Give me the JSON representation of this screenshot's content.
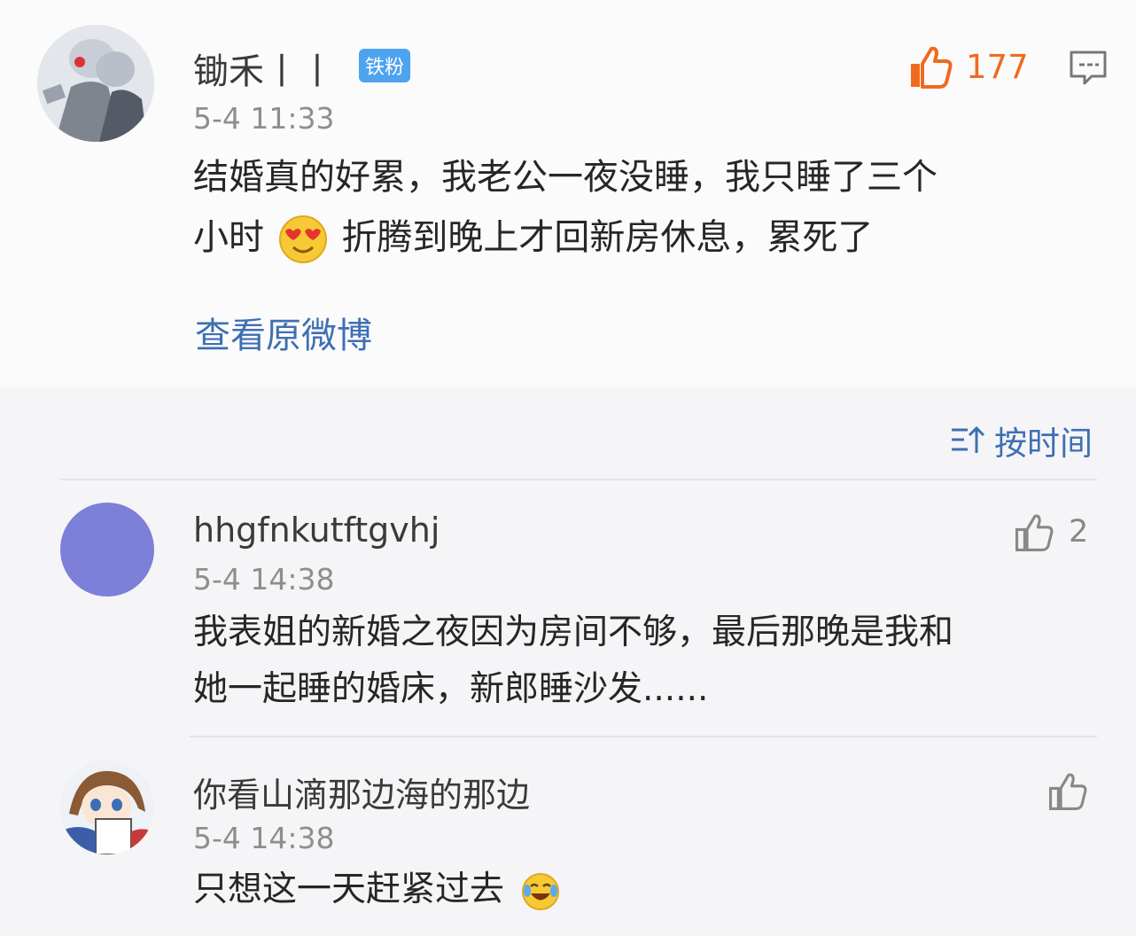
{
  "main_post": {
    "username": "锄禾丨丨",
    "badge": "铁粉",
    "timestamp": "5-4 11:33",
    "like_count": "177",
    "text_line1": "结婚真的好累，我老公一夜没睡，我只睡了三个",
    "text_line2_a": "小时",
    "text_line2_b": "折腾到晚上才回新房休息，累死了",
    "view_original": "查看原微博"
  },
  "sort": {
    "label": "按时间"
  },
  "comments": [
    {
      "username": "hhgfnkutftgvhj",
      "timestamp": "5-4 14:38",
      "like_count": "2",
      "text_line1": "我表姐的新婚之夜因为房间不够，最后那晚是我和",
      "text_line2": "她一起睡的婚床，新郎睡沙发......"
    },
    {
      "username": "你看山滴那边海的那边",
      "timestamp": "5-4 14:38",
      "text_line1": "只想这一天赶紧过去"
    }
  ],
  "colors": {
    "accent_orange": "#f06a1e",
    "link_blue": "#3e6fb4",
    "badge_blue": "#4da3ee",
    "avatar_purple": "#7d80d8"
  }
}
